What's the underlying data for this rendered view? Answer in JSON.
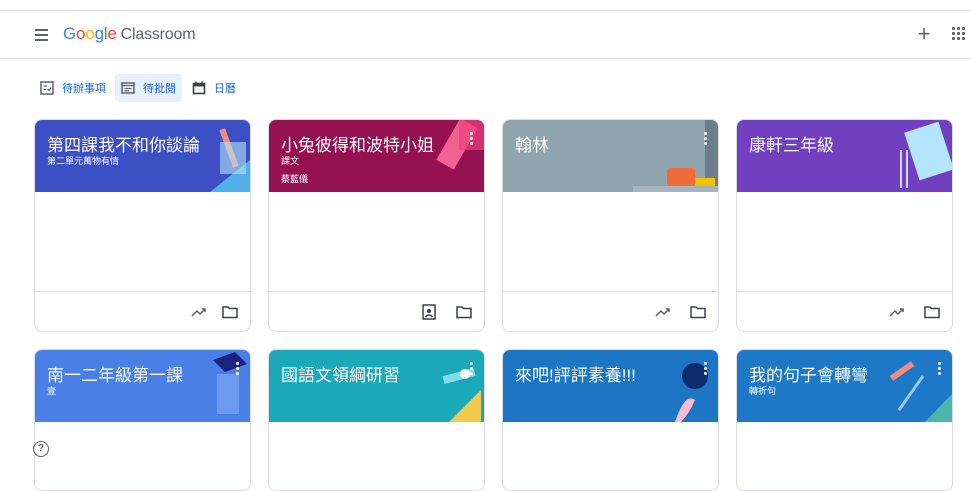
{
  "app": {
    "logo_parts": [
      "G",
      "o",
      "o",
      "g",
      "l",
      "e"
    ],
    "product": "Classroom"
  },
  "header": {
    "menu_icon": "hamburger-menu-icon",
    "create_icon": "plus-icon",
    "create_glyph": "+",
    "apps_icon": "google-apps-grid-icon"
  },
  "subnav": {
    "items": [
      {
        "label": "待辦事項",
        "icon": "todo-checklist-icon"
      },
      {
        "label": "待批閱",
        "icon": "review-icon",
        "active": true
      },
      {
        "label": "日曆",
        "icon": "calendar-icon"
      }
    ]
  },
  "classes": [
    {
      "title": "第四課我不和你談論",
      "section": "第二單元萬物有情",
      "teacher": "",
      "color": "#3d4fc5",
      "icons": [
        "trending-up-icon",
        "folder-icon"
      ]
    },
    {
      "title": "小兔彼得和波特小姐",
      "section": "課文",
      "teacher": "蔡藍儀",
      "color": "#951150",
      "icons": [
        "assignment-ind-icon",
        "folder-icon"
      ]
    },
    {
      "title": "翰林",
      "section": "",
      "teacher": "",
      "color": "#90a4ae",
      "icons": [
        "trending-up-icon",
        "folder-icon"
      ]
    },
    {
      "title": "康軒三年級",
      "section": "",
      "teacher": "",
      "color": "#7040c0",
      "icons": [
        "trending-up-icon",
        "folder-icon"
      ]
    },
    {
      "title": "南一二年級第一課",
      "section": "壹",
      "teacher": "",
      "color": "#4a7fe6"
    },
    {
      "title": "國語文領綱研習",
      "section": "",
      "teacher": "",
      "color": "#1ba8b8"
    },
    {
      "title": "來吧!評評素養!!!",
      "section": "",
      "teacher": "",
      "color": "#1c76c4"
    },
    {
      "title": "我的句子會轉彎",
      "section": "轉折句",
      "teacher": "",
      "color": "#1e78c8"
    }
  ],
  "footer": {
    "help_glyph": "?",
    "help_icon": "help-icon"
  }
}
